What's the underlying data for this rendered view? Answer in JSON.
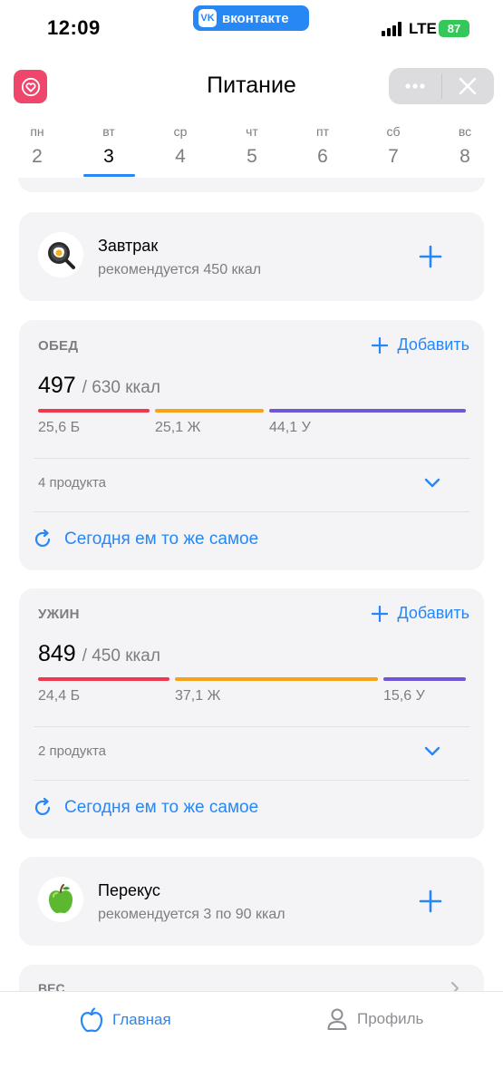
{
  "status_bar": {
    "time": "12:09",
    "app_badge": "вконтакте",
    "app_badge_logo": "VK",
    "network": "LTE",
    "battery": "87"
  },
  "header": {
    "title": "Питание"
  },
  "week": [
    {
      "name": "пн",
      "date": "2",
      "active": false
    },
    {
      "name": "вт",
      "date": "3",
      "active": true
    },
    {
      "name": "ср",
      "date": "4",
      "active": false
    },
    {
      "name": "чт",
      "date": "5",
      "active": false
    },
    {
      "name": "пт",
      "date": "6",
      "active": false
    },
    {
      "name": "сб",
      "date": "7",
      "active": false
    },
    {
      "name": "вс",
      "date": "8",
      "active": false
    }
  ],
  "breakfast": {
    "name": "Завтрак",
    "subtitle": "рекомендуется 450 ккал",
    "icon": "frying-pan-egg-icon"
  },
  "lunch": {
    "title": "ОБЕД",
    "add_label": "Добавить",
    "kcal": "497",
    "target": "/ 630 ккал",
    "protein": "25,6 Б",
    "fat": "25,1 Ж",
    "carbs": "44,1 У",
    "products": "4 продукта",
    "repeat_label": "Сегодня ем то же самое"
  },
  "dinner": {
    "title": "УЖИН",
    "add_label": "Добавить",
    "kcal": "849",
    "target": "/ 450 ккал",
    "protein": "24,4 Б",
    "fat": "37,1 Ж",
    "carbs": "15,6 У",
    "products": "2 продукта",
    "repeat_label": "Сегодня ем то же самое"
  },
  "snack": {
    "name": "Перекус",
    "subtitle": "рекомендуется 3 по 90 ккал",
    "icon": "green-apple-icon"
  },
  "weight_card": {
    "label": "ВЕС"
  },
  "tabs": {
    "home": "Главная",
    "profile": "Профиль"
  },
  "colors": {
    "accent": "#2787f5",
    "protein": "#f0384f",
    "fat": "#f7a21b",
    "carbs": "#6f55d8",
    "card_bg": "#f4f4f6",
    "battery": "#34c759"
  }
}
